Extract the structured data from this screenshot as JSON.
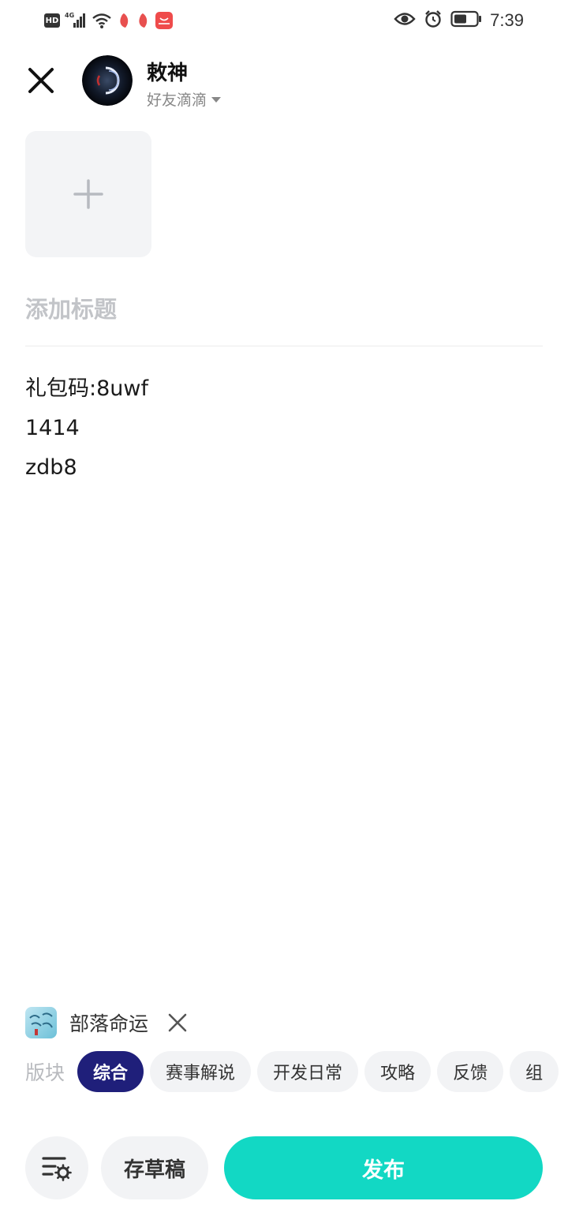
{
  "status_bar": {
    "hd": "HD",
    "network": "4G",
    "time": "7:39",
    "battery_level": 0.55,
    "icons": [
      "hd-icon",
      "signal-icon",
      "wifi-icon",
      "app-notification-icon",
      "app-notification-icon",
      "app-store-icon",
      "eye-icon",
      "alarm-icon",
      "battery-icon"
    ]
  },
  "header": {
    "close_icon": "close-icon",
    "user_name": "敕神",
    "visibility": "好友滴滴"
  },
  "editor": {
    "add_image_icon": "plus-icon",
    "title_placeholder": "添加标题",
    "title_value": "",
    "content_lines": [
      "礼包码:8uwf",
      "1414",
      "zdb8"
    ]
  },
  "game_tag": {
    "name": "部落命运",
    "remove_icon": "close-icon"
  },
  "sections": {
    "label": "版块",
    "items": [
      "综合",
      "赛事解说",
      "开发日常",
      "攻略",
      "反馈",
      "组"
    ],
    "active_index": 0
  },
  "footer": {
    "settings_icon": "settings-list-icon",
    "draft_label": "存草稿",
    "publish_label": "发布"
  },
  "colors": {
    "accent": "#12d8c4",
    "active_chip": "#1f1f7a",
    "chip_bg": "#f2f3f5"
  }
}
